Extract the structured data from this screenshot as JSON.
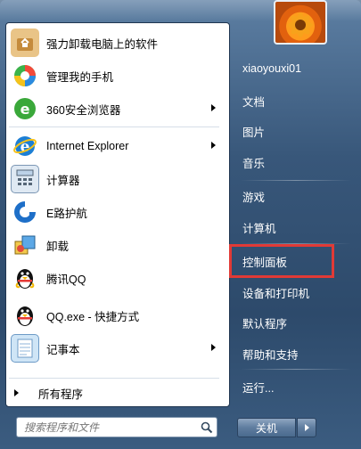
{
  "programs": [
    {
      "label": "强力卸载电脑上的软件",
      "icon": "uninstall-box-icon",
      "has_submenu": false
    },
    {
      "label": "管理我的手机",
      "icon": "phone-manager-icon",
      "has_submenu": false
    },
    {
      "label": "360安全浏览器",
      "icon": "360-browser-icon",
      "has_submenu": true
    },
    {
      "label": "Internet Explorer",
      "icon": "internet-explorer-icon",
      "has_submenu": true
    },
    {
      "label": "计算器",
      "icon": "calculator-icon",
      "has_submenu": false
    },
    {
      "label": "E路护航",
      "icon": "e-guard-icon",
      "has_submenu": false
    },
    {
      "label": "卸载",
      "icon": "uninstall-icon",
      "has_submenu": false
    },
    {
      "label": "腾讯QQ",
      "icon": "qq-penguin-icon",
      "has_submenu": false
    },
    {
      "label": "QQ.exe - 快捷方式",
      "icon": "qq-shortcut-icon",
      "has_submenu": false
    },
    {
      "label": "记事本",
      "icon": "notepad-icon",
      "has_submenu": true
    }
  ],
  "all_programs_label": "所有程序",
  "search": {
    "placeholder": "搜索程序和文件"
  },
  "right_items": [
    {
      "label": "xiaoyouxi01",
      "name": "user-name"
    },
    {
      "label": "文档",
      "name": "documents"
    },
    {
      "label": "图片",
      "name": "pictures"
    },
    {
      "label": "音乐",
      "name": "music"
    },
    {
      "label": "游戏",
      "name": "games"
    },
    {
      "label": "计算机",
      "name": "computer"
    },
    {
      "label": "控制面板",
      "name": "control-panel"
    },
    {
      "label": "设备和打印机",
      "name": "devices-and-printers"
    },
    {
      "label": "默认程序",
      "name": "default-programs"
    },
    {
      "label": "帮助和支持",
      "name": "help-and-support"
    },
    {
      "label": "运行...",
      "name": "run"
    }
  ],
  "shutdown_label": "关机",
  "colors": {
    "highlight": "#e13a36"
  }
}
